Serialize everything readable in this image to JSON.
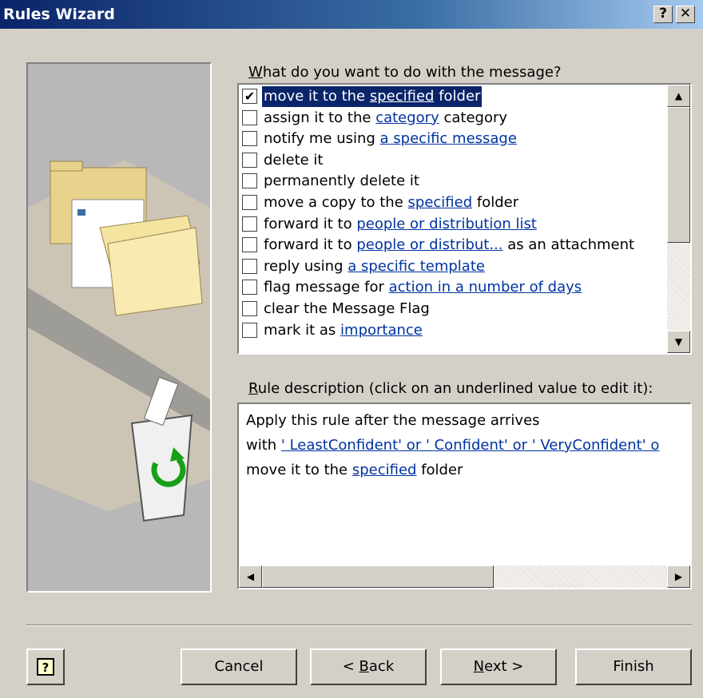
{
  "window": {
    "title": "Rules Wizard"
  },
  "titlebar": {
    "help_glyph": "?",
    "close_glyph": "✕"
  },
  "actions_prompt": {
    "prefix": "",
    "mnemonic": "W",
    "suffix": "hat do you want to do with the message?"
  },
  "actions": [
    {
      "checked": true,
      "pre": "move it to the ",
      "link": "specified",
      "post": " folder"
    },
    {
      "checked": false,
      "pre": "assign it to the ",
      "link": "category",
      "post": " category"
    },
    {
      "checked": false,
      "pre": "notify me using ",
      "link": "a specific message",
      "post": ""
    },
    {
      "checked": false,
      "pre": "delete it",
      "link": "",
      "post": ""
    },
    {
      "checked": false,
      "pre": "permanently delete it",
      "link": "",
      "post": ""
    },
    {
      "checked": false,
      "pre": "move a copy to the ",
      "link": "specified",
      "post": " folder"
    },
    {
      "checked": false,
      "pre": "forward it to ",
      "link": "people or distribution list",
      "post": ""
    },
    {
      "checked": false,
      "pre": "forward it to ",
      "link": "people or distribut...",
      "post": " as an attachment"
    },
    {
      "checked": false,
      "pre": "reply using ",
      "link": "a specific template",
      "post": ""
    },
    {
      "checked": false,
      "pre": "flag message for ",
      "link": "action in a number of days",
      "post": ""
    },
    {
      "checked": false,
      "pre": "clear the Message Flag",
      "link": "",
      "post": ""
    },
    {
      "checked": false,
      "pre": "mark it as ",
      "link": "importance",
      "post": ""
    }
  ],
  "description_prompt": {
    "mnemonic": "R",
    "suffix": "ule description (click on an underlined value to edit it):"
  },
  "description": {
    "line1": "Apply this rule after the message arrives",
    "line2_pre": "with ",
    "line2_link": "' LeastConfident' or ' Confident' or ' VeryConfident' o",
    "line3_pre": "move it to the ",
    "line3_link": "specified",
    "line3_post": " folder"
  },
  "buttons": {
    "help_glyph": "?",
    "cancel": "Cancel",
    "back_pre": "< ",
    "back_mnemonic": "B",
    "back_post": "ack",
    "next_mnemonic": "N",
    "next_post": "ext >",
    "finish": "Finish"
  },
  "scroll_arrows": {
    "up": "▲",
    "down": "▼",
    "left": "◀",
    "right": "▶"
  },
  "colors": {
    "title_start": "#0a246a",
    "selection": "#0a246a",
    "link": "#0033a0",
    "dialog_bg": "#d4d0c8"
  }
}
